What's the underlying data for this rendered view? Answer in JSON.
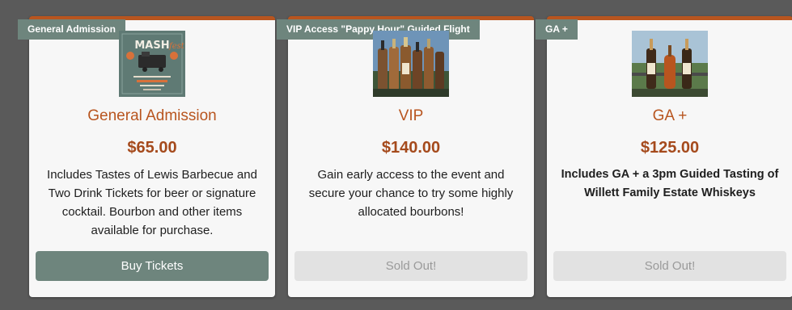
{
  "colors": {
    "background": "#5a5a5a",
    "card": "#f7f7f7",
    "accent": "#b8551f",
    "tag": "#6e857d",
    "buy_button": "#6e857d",
    "sold_button": "#e2e2e2"
  },
  "tickets": [
    {
      "tag": "General Admission",
      "image": "mashfest-poster-image",
      "poster_text": "MASH",
      "title": "General Admission",
      "price": "$65.00",
      "description": "Includes Tastes of Lewis Barbecue and Two Drink Tickets for beer or signature cocktail. Bourbon and other items available for purchase.",
      "button": "Buy Tickets"
    },
    {
      "tag": "VIP Access \"Pappy Hour\" Guided Flight",
      "image": "bourbon-bottles-image",
      "title": "VIP",
      "price": "$140.00",
      "description": "Gain early access to the event and secure your chance to try some highly allocated bourbons!",
      "button": "Sold Out!"
    },
    {
      "tag": "GA +",
      "image": "willett-bottles-image",
      "title": "GA +",
      "price": "$125.00",
      "description": "Includes GA + a 3pm Guided Tasting of Willett Family Estate Whiskeys",
      "button": "Sold Out!"
    }
  ]
}
